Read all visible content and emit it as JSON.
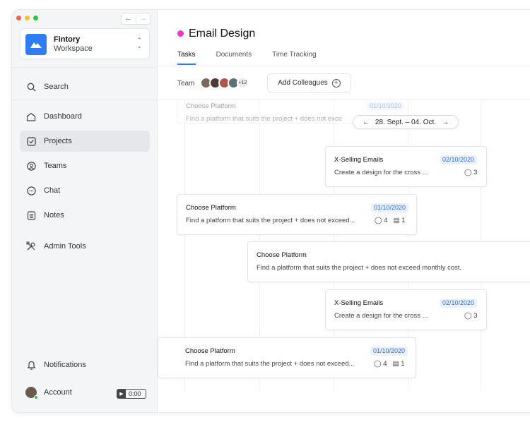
{
  "sidebar": {
    "workspace": {
      "name": "Fintory",
      "subtitle": "Workspace"
    },
    "search": "Search",
    "items": [
      {
        "label": "Dashboard"
      },
      {
        "label": "Projects"
      },
      {
        "label": "Teams"
      },
      {
        "label": "Chat"
      },
      {
        "label": "Notes"
      },
      {
        "label": "Admin Tools"
      }
    ],
    "notifications": "Notifications",
    "account": "Account",
    "timer": "0:00"
  },
  "header": {
    "title": "Email Design",
    "title_dot_color": "#e83ac6",
    "tabs": [
      "Tasks",
      "Documents",
      "Time Tracking"
    ],
    "active_tab": "Tasks"
  },
  "team": {
    "label": "Team",
    "more_count": "+12",
    "add_button": "Add Colleagues"
  },
  "timeline": {
    "date_range": "28. Sept. – 04. Oct.",
    "cards": [
      {
        "title": "Choose Platform",
        "desc": "Find a platform that suits the project + does not exce",
        "date": "01/10/2020"
      },
      {
        "title": "X-Selling Emails",
        "desc": "Create a design for the cross ...",
        "date": "02/10/2020",
        "comments": "3"
      },
      {
        "title": "Choose Platform",
        "desc": "Find a platform that suits the project + does not exceed...",
        "date": "01/10/2020",
        "comments": "4",
        "files": "1"
      },
      {
        "title": "Choose Platform",
        "desc": "Find a platform that suits the project + does not exceed monthly cost."
      },
      {
        "title": "X-Selling Emails",
        "desc": "Create a design for the cross ...",
        "date": "02/10/2020",
        "comments": "3"
      },
      {
        "title": "Choose Platform",
        "desc": "Find a platform that suits the project + does not exceed...",
        "date": "01/10/2020",
        "comments": "4",
        "files": "1"
      }
    ]
  },
  "colors": {
    "accent": "#2f7cf6",
    "active_nav": "#e6e7ea",
    "date_badge": "#e9f1fe"
  }
}
